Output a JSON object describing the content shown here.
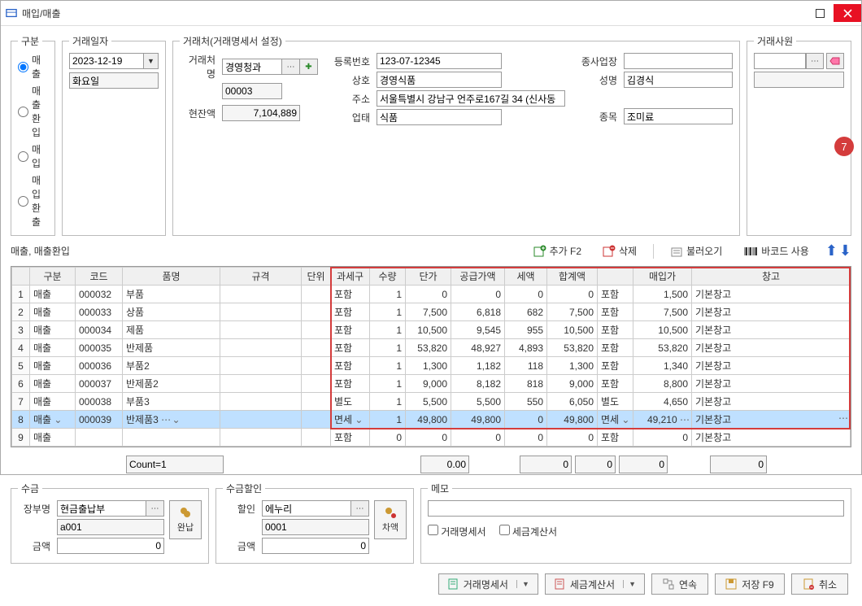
{
  "window": {
    "title": "매입/매출"
  },
  "gubun": {
    "legend": "구분",
    "options": [
      "매출",
      "매출환입",
      "매입",
      "매입환출"
    ],
    "selected": 0
  },
  "dateBox": {
    "legend": "거래일자",
    "date": "2023-12-19",
    "weekday": "화요일"
  },
  "partner": {
    "legend": "거래처(거래명세서 설정)",
    "labels": {
      "name": "거래처명",
      "code": "00003",
      "regno": "등록번호",
      "company": "상호",
      "addr": "주소",
      "biz": "업태",
      "sub": "종사업장",
      "manager": "성명",
      "item": "종목",
      "balance": "현잔액"
    },
    "values": {
      "name": "경영청과",
      "code": "00003",
      "regno": "123-07-12345",
      "company": "경영식품",
      "addr": "서울특별시 강남구 언주로167길 34 (신사동",
      "biz": "식품",
      "sub": "",
      "manager": "김경식",
      "item": "조미료",
      "balance": "7,104,889"
    }
  },
  "salesman": {
    "legend": "거래사원",
    "value": ""
  },
  "subtitle": "매출, 매출환입",
  "toolbar": {
    "add": "추가 F2",
    "delete": "삭제",
    "load": "불러오기",
    "barcode": "바코드 사용"
  },
  "badge": "7",
  "columns": [
    "구분",
    "코드",
    "품명",
    "규격",
    "단위",
    "과세구",
    "수량",
    "단가",
    "공급가액",
    "세액",
    "합계액",
    "",
    "매입가",
    "창고"
  ],
  "rows": [
    {
      "gubun": "매출",
      "code": "000032",
      "name": "부품",
      "spec": "",
      "unit": "",
      "tax": "포함",
      "qty": "1",
      "price": "0",
      "supply": "0",
      "vat": "0",
      "total": "0",
      "taxIn": "포함",
      "buy": "1,500",
      "wh": "기본창고"
    },
    {
      "gubun": "매출",
      "code": "000033",
      "name": "상품",
      "spec": "",
      "unit": "",
      "tax": "포함",
      "qty": "1",
      "price": "7,500",
      "supply": "6,818",
      "vat": "682",
      "total": "7,500",
      "taxIn": "포함",
      "buy": "7,500",
      "wh": "기본창고"
    },
    {
      "gubun": "매출",
      "code": "000034",
      "name": "제품",
      "spec": "",
      "unit": "",
      "tax": "포함",
      "qty": "1",
      "price": "10,500",
      "supply": "9,545",
      "vat": "955",
      "total": "10,500",
      "taxIn": "포함",
      "buy": "10,500",
      "wh": "기본창고"
    },
    {
      "gubun": "매출",
      "code": "000035",
      "name": "반제품",
      "spec": "",
      "unit": "",
      "tax": "포함",
      "qty": "1",
      "price": "53,820",
      "supply": "48,927",
      "vat": "4,893",
      "total": "53,820",
      "taxIn": "포함",
      "buy": "53,820",
      "wh": "기본창고"
    },
    {
      "gubun": "매출",
      "code": "000036",
      "name": "부품2",
      "spec": "",
      "unit": "",
      "tax": "포함",
      "qty": "1",
      "price": "1,300",
      "supply": "1,182",
      "vat": "118",
      "total": "1,300",
      "taxIn": "포함",
      "buy": "1,340",
      "wh": "기본창고"
    },
    {
      "gubun": "매출",
      "code": "000037",
      "name": "반제품2",
      "spec": "",
      "unit": "",
      "tax": "포함",
      "qty": "1",
      "price": "9,000",
      "supply": "8,182",
      "vat": "818",
      "total": "9,000",
      "taxIn": "포함",
      "buy": "8,800",
      "wh": "기본창고"
    },
    {
      "gubun": "매출",
      "code": "000038",
      "name": "부품3",
      "spec": "",
      "unit": "",
      "tax": "별도",
      "qty": "1",
      "price": "5,500",
      "supply": "5,500",
      "vat": "550",
      "total": "6,050",
      "taxIn": "별도",
      "buy": "4,650",
      "wh": "기본창고"
    },
    {
      "gubun": "매출",
      "code": "000039",
      "name": "반제품3",
      "spec": "",
      "unit": "",
      "tax": "면세",
      "qty": "1",
      "price": "49,800",
      "supply": "49,800",
      "vat": "0",
      "total": "49,800",
      "taxIn": "면세",
      "buy": "49,210",
      "wh": "기본창고",
      "selected": true
    },
    {
      "gubun": "매출",
      "code": "",
      "name": "",
      "spec": "",
      "unit": "",
      "tax": "포함",
      "qty": "0",
      "price": "0",
      "supply": "0",
      "vat": "0",
      "total": "0",
      "taxIn": "포함",
      "buy": "0",
      "wh": "기본창고"
    }
  ],
  "totals": {
    "count": "Count=1",
    "qty": "0.00",
    "supply": "0",
    "vat": "0",
    "total": "0",
    "buy": "0"
  },
  "receipt": {
    "legend": "수금",
    "ledgerLabel": "장부명",
    "ledger": "현금출납부",
    "ledgerCode": "a001",
    "amountLabel": "금액",
    "amount": "0",
    "completeBtn": "완납"
  },
  "discount": {
    "legend": "수금할인",
    "label": "할인",
    "name": "에누리",
    "code": "0001",
    "amountLabel": "금액",
    "amount": "0",
    "diffBtn": "차액"
  },
  "memo": {
    "legend": "메모",
    "text": "",
    "chk1": "거래명세서",
    "chk2": "세금계산서"
  },
  "footer": {
    "stmt": "거래명세서",
    "tax": "세금계산서",
    "cont": "연속",
    "save": "저장 F9",
    "cancel": "취소"
  }
}
